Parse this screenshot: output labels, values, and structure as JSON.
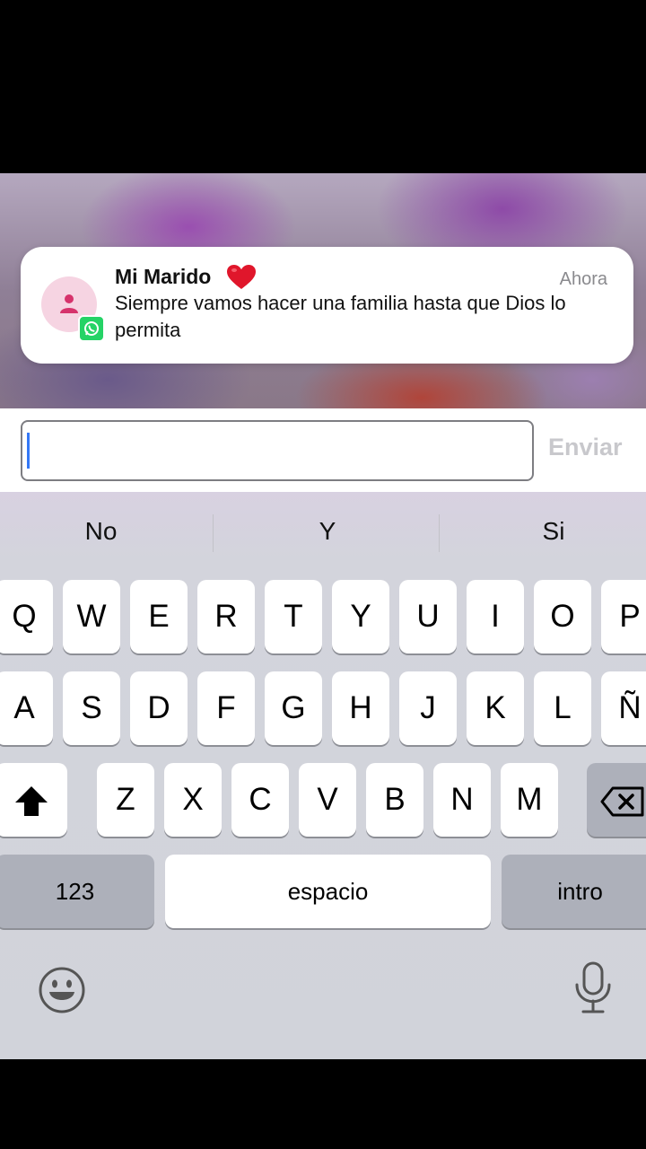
{
  "notification": {
    "title": "Mi Marido",
    "title_emoji": "red-heart-icon",
    "time": "Ahora",
    "body": "Siempre vamos hacer una familia hasta que Dios lo permita",
    "app_icon": "whatsapp-icon",
    "avatar_color": "#f6d4e2"
  },
  "reply": {
    "input_value": "",
    "send_label": "Enviar"
  },
  "keyboard": {
    "suggestions": [
      "No",
      "Y",
      "Si"
    ],
    "row1": [
      "Q",
      "W",
      "E",
      "R",
      "T",
      "Y",
      "U",
      "I",
      "O",
      "P"
    ],
    "row2": [
      "A",
      "S",
      "D",
      "F",
      "G",
      "H",
      "J",
      "K",
      "L",
      "Ñ"
    ],
    "row3": [
      "Z",
      "X",
      "C",
      "V",
      "B",
      "N",
      "M"
    ],
    "numbers_label": "123",
    "space_label": "espacio",
    "return_label": "intro"
  },
  "colors": {
    "caret": "#3478f6",
    "whatsapp": "#25d366",
    "send_disabled": "#c8c8cc"
  }
}
